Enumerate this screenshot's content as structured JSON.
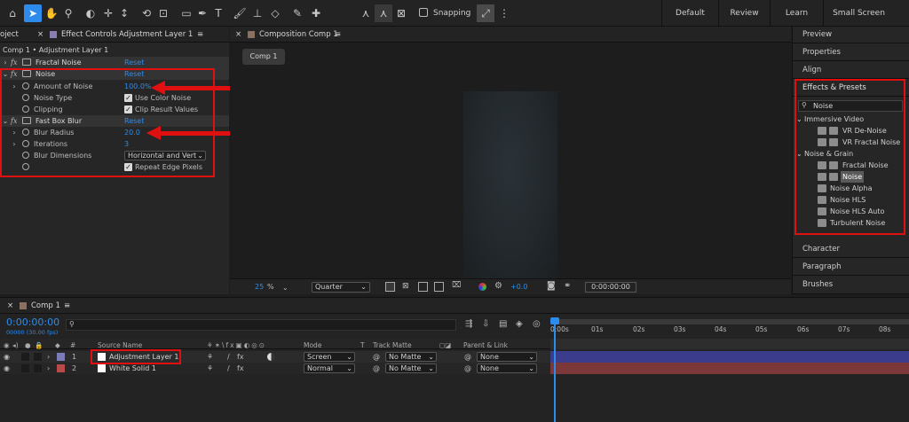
{
  "workspaces": [
    "Default",
    "Review",
    "Learn",
    "Small Screen"
  ],
  "toolbar": {
    "snapping_label": "Snapping"
  },
  "effect_controls": {
    "left_tab": "oject",
    "tab_title": "Effect Controls Adjustment Layer 1",
    "breadcrumb": "Comp 1 • Adjustment Layer 1",
    "reset_label": "Reset",
    "rows": [
      {
        "label": "Fractal Noise",
        "value": "Reset"
      },
      {
        "label": "Noise",
        "value": "Reset"
      },
      {
        "label": "Amount of Noise",
        "value": "100.0%"
      },
      {
        "label": "Noise Type",
        "value": "Use Color Noise"
      },
      {
        "label": "Clipping",
        "value": "Clip Result Values"
      },
      {
        "label": "Fast Box Blur",
        "value": "Reset"
      },
      {
        "label": "Blur Radius",
        "value": "20.0"
      },
      {
        "label": "Iterations",
        "value": "3"
      },
      {
        "label": "Blur Dimensions",
        "value": "Horizontal and Vert"
      },
      {
        "label": "",
        "value": "Repeat Edge Pixels"
      }
    ]
  },
  "composition": {
    "tab_title": "Composition Comp 1",
    "comp_tab": "Comp 1",
    "zoom": "25",
    "zoom_unit": "%",
    "resolution": "Quarter",
    "exposure": "+0.0",
    "timecode": "0:00:00:00"
  },
  "right_panel": {
    "preview": "Preview",
    "properties": "Properties",
    "align": "Align",
    "effects_presets": "Effects & Presets",
    "search_value": "Noise",
    "group1": "Immersive Video",
    "group1_items": [
      "VR De-Noise",
      "VR Fractal Noise"
    ],
    "group2": "Noise & Grain",
    "group2_items": [
      "Fractal Noise",
      "Noise",
      "Noise Alpha",
      "Noise HLS",
      "Noise HLS Auto",
      "Turbulent Noise"
    ],
    "character": "Character",
    "paragraph": "Paragraph",
    "brushes": "Brushes"
  },
  "timeline": {
    "tab_title": "Comp 1",
    "timecode": "0:00:00:00",
    "fps": "00000 (30.00 fps)",
    "ruler": [
      "0:00s",
      "01s",
      "02s",
      "03s",
      "04s",
      "05s",
      "06s",
      "07s",
      "08s"
    ],
    "columns": {
      "num": "#",
      "source_name": "Source Name",
      "mode": "Mode",
      "t": "T",
      "track_matte": "Track Matte",
      "parent": "Parent & Link"
    },
    "layers": [
      {
        "num": "1",
        "name": "Adjustment Layer 1",
        "mode": "Screen",
        "matte": "No Matte",
        "parent": "None",
        "color": "#7b7bb5",
        "bar": "#3c3c8c"
      },
      {
        "num": "2",
        "name": "White Solid 1",
        "mode": "Normal",
        "matte": "No Matte",
        "parent": "None",
        "color": "#b84a4a",
        "bar": "#7c3838"
      }
    ]
  },
  "colors": {
    "accent": "#2d8ceb",
    "highlight": "#e01010"
  }
}
